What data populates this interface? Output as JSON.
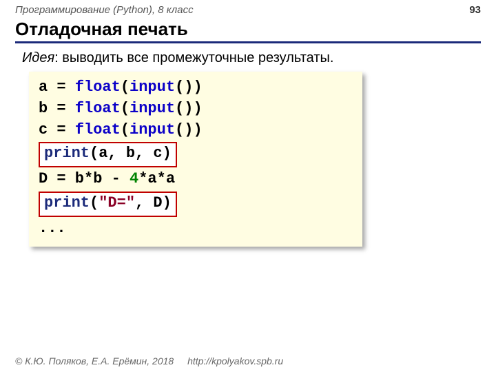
{
  "header": {
    "course": "Программирование (Python), 8 класс",
    "page": "93"
  },
  "title": "Отладочная печать",
  "idea": {
    "label": "Идея",
    "text": ": выводить все промежуточные результаты."
  },
  "code": {
    "l1": {
      "a": "a = ",
      "b": "float",
      "c": "(",
      "d": "input",
      "e": "())"
    },
    "l2": {
      "a": "b = ",
      "b": "float",
      "c": "(",
      "d": "input",
      "e": "())"
    },
    "l3": {
      "a": "c = ",
      "b": "float",
      "c": "(",
      "d": "input",
      "e": "())"
    },
    "l4": {
      "a": "print",
      "b": "(a, b, c)"
    },
    "l5": {
      "a": "D = b*b - ",
      "b": "4",
      "c": "*a*a"
    },
    "l6": {
      "a": "print",
      "b": "(",
      "c": "\"D=\"",
      "d": ", D)"
    },
    "l7": "..."
  },
  "footer": {
    "copyright": "© К.Ю. Поляков, Е.А. Ерёмин, 2018",
    "url": "http://kpolyakov.spb.ru"
  }
}
